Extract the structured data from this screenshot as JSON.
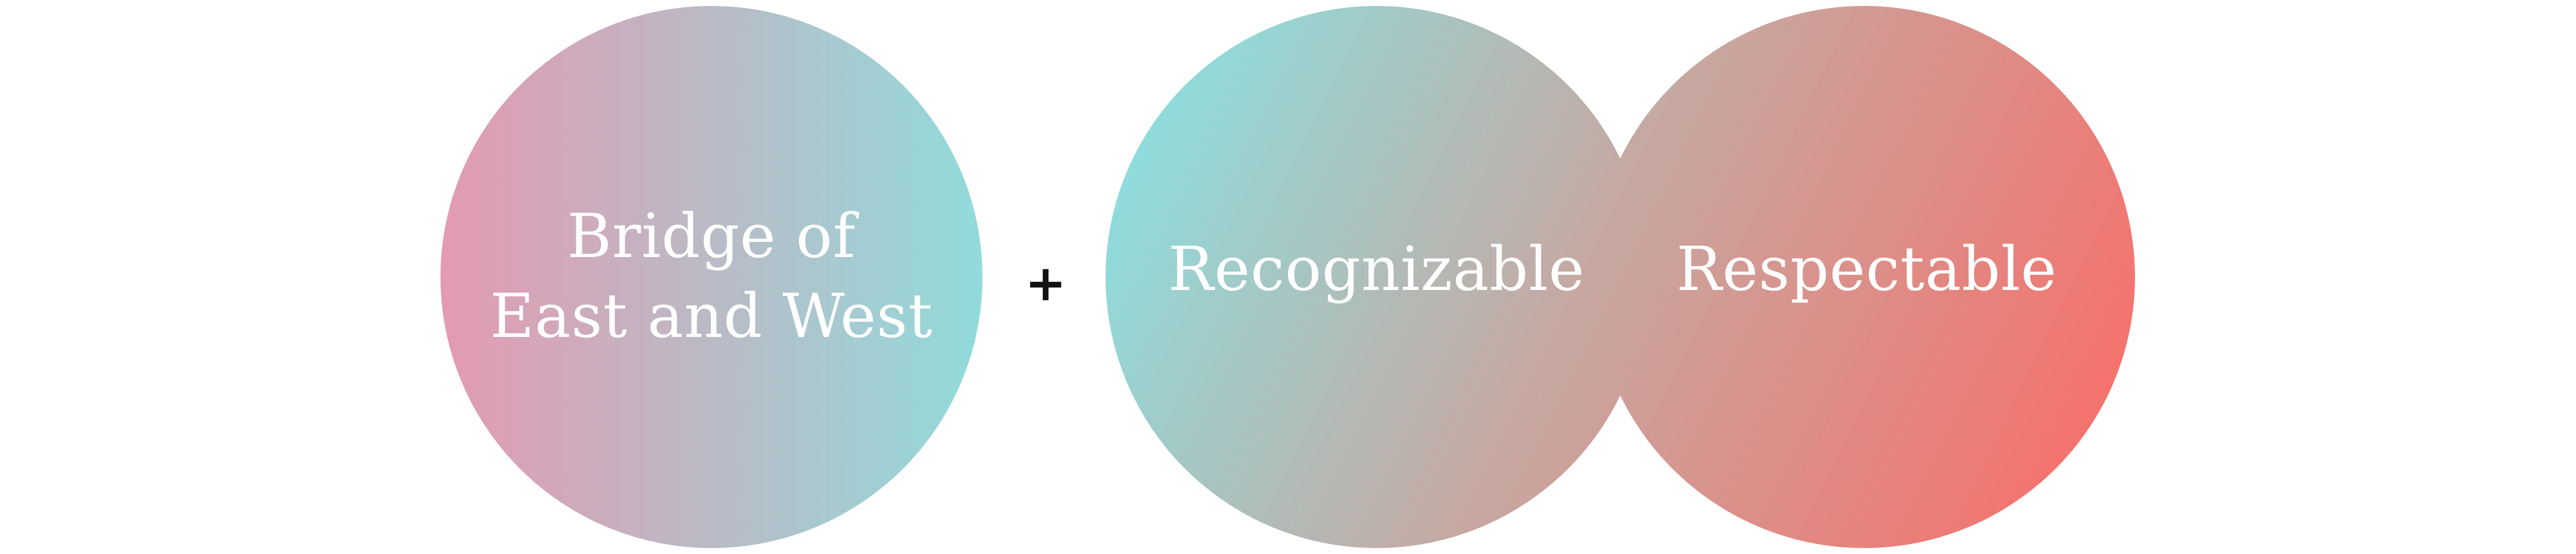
{
  "diagram": {
    "left_circle": {
      "label_line1": "Bridge of",
      "label_line2": "East and West",
      "gradient_colors": [
        "#e39ab1",
        "#91dbdb"
      ]
    },
    "operator": "+",
    "overlap_pair": {
      "left_label": "Recognizable",
      "right_label": "Respectable",
      "gradient_colors": [
        "#8fdcdc",
        "#c5a9a2",
        "#f7706b"
      ]
    },
    "label_color": "#ffffff"
  }
}
